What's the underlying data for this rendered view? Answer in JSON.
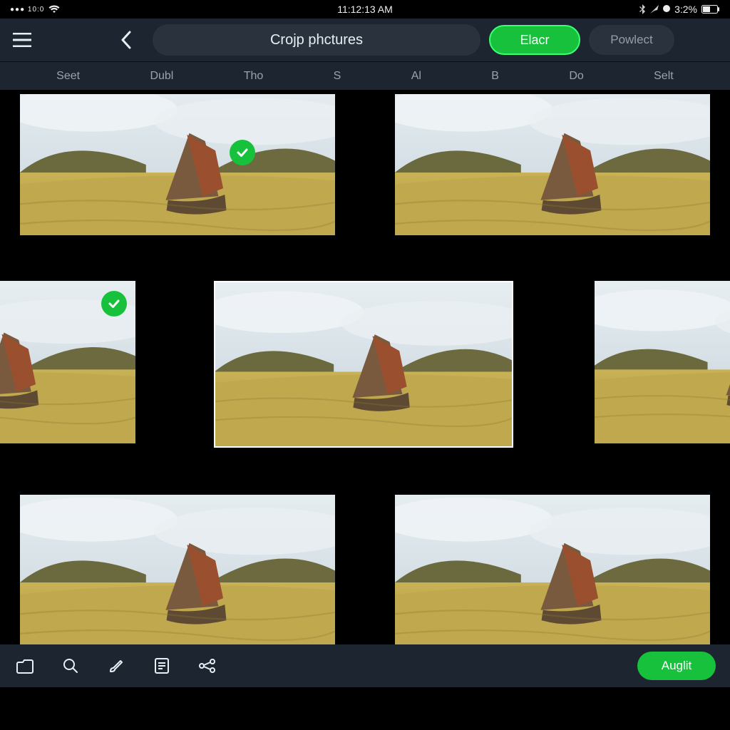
{
  "status": {
    "left_signal": "●●● 10:0",
    "clock": "11:12:13 AM",
    "right_pct": "3:2%"
  },
  "header": {
    "title": "Crojp phctures",
    "primary": "Elacr",
    "secondary": "Powlect"
  },
  "tabs": [
    "Seet",
    "Dubl",
    "Tho",
    "S",
    "Al",
    "B",
    "Do",
    "Selt"
  ],
  "thumbs": [
    {
      "selected": true
    },
    {
      "selected": false
    },
    {
      "selected": true
    },
    {
      "selected": false
    },
    {
      "selected": false
    },
    {
      "selected": false
    },
    {
      "selected": false
    }
  ],
  "footer": {
    "apply": "Auglit"
  },
  "colors": {
    "accent": "#18c13c"
  }
}
